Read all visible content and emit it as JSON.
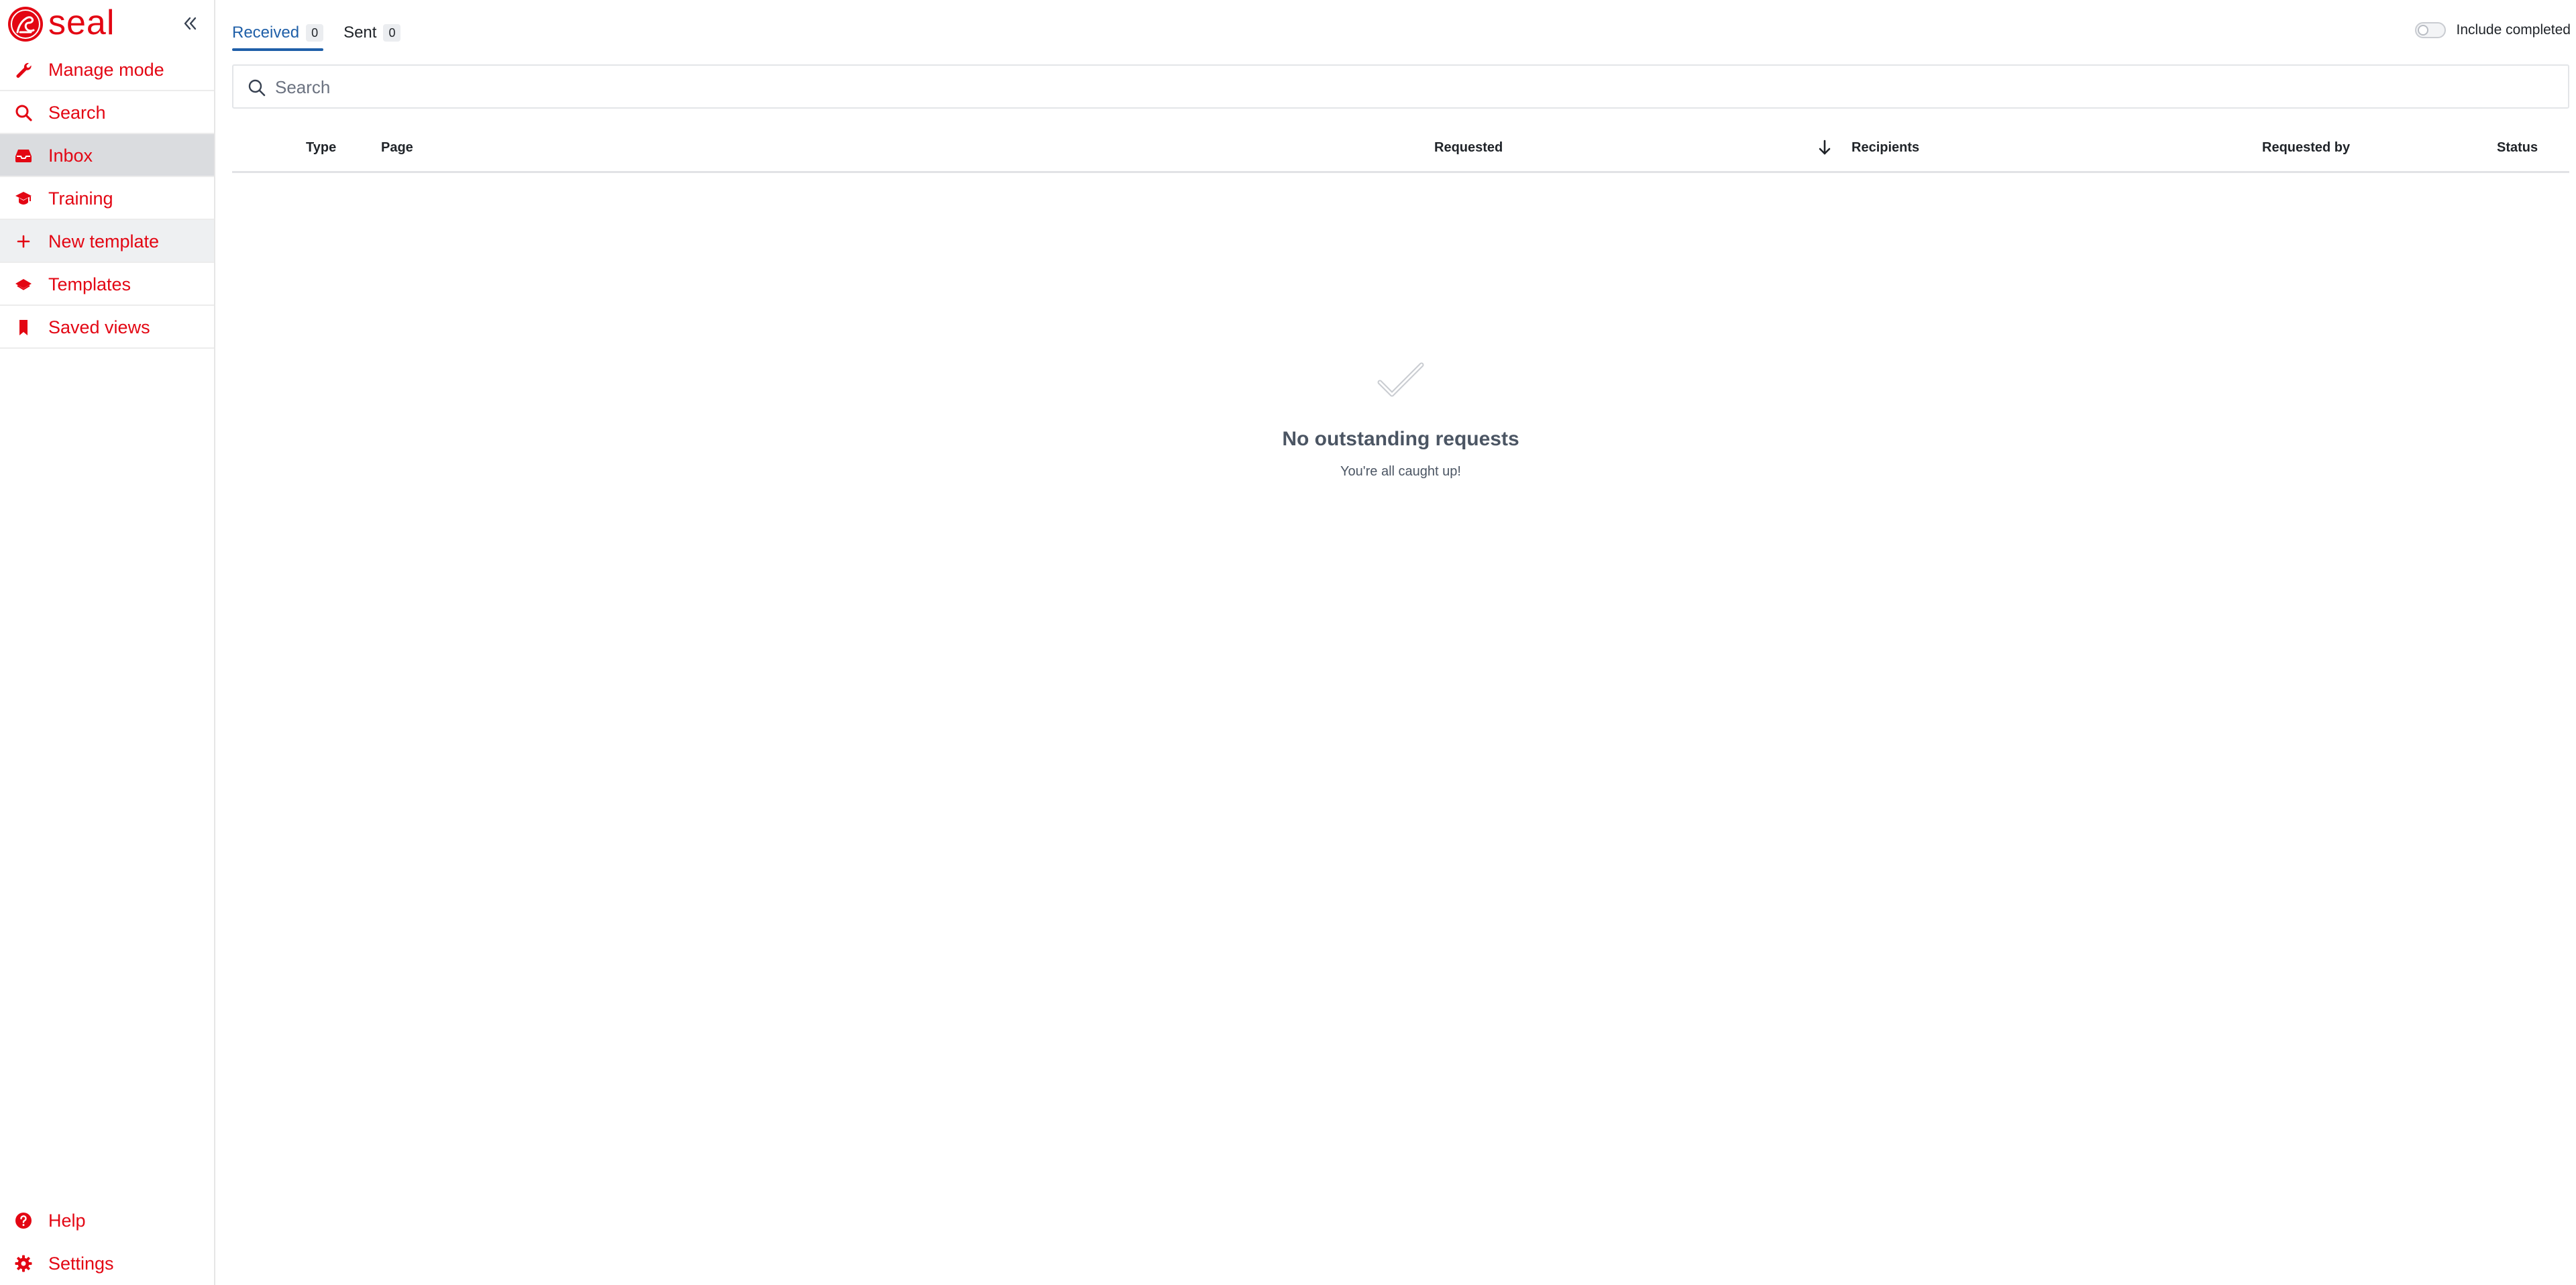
{
  "app": {
    "brand_name": "seal",
    "brand_color": "#e30613",
    "accent_color": "#1f5fa8"
  },
  "sidebar": {
    "collapse_icon": "double-chevron-left-icon",
    "items": [
      {
        "label": "Manage mode",
        "icon": "wrench-icon"
      },
      {
        "label": "Search",
        "icon": "search-icon"
      },
      {
        "label": "Inbox",
        "icon": "inbox-icon",
        "active": true
      },
      {
        "label": "Training",
        "icon": "graduation-cap-icon"
      },
      {
        "label": "New template",
        "icon": "plus-icon"
      },
      {
        "label": "Templates",
        "icon": "layers-icon"
      },
      {
        "label": "Saved views",
        "icon": "bookmark-icon"
      }
    ],
    "bottom_items": [
      {
        "label": "Help",
        "icon": "help-circle-icon"
      },
      {
        "label": "Settings",
        "icon": "gear-icon"
      }
    ]
  },
  "tabs": [
    {
      "label": "Received",
      "count": "0",
      "active": true
    },
    {
      "label": "Sent",
      "count": "0",
      "active": false
    }
  ],
  "include_completed": {
    "label": "Include completed",
    "enabled": false
  },
  "search": {
    "placeholder": "Search",
    "value": ""
  },
  "table": {
    "columns": {
      "type": "Type",
      "page": "Page",
      "requested": "Requested",
      "recipients": "Recipients",
      "requested_by": "Requested by",
      "status": "Status"
    },
    "sort_icon": "arrow-down-icon",
    "rows": []
  },
  "empty_state": {
    "icon": "checkmark-icon",
    "title": "No outstanding requests",
    "subtitle": "You're all caught up!"
  }
}
